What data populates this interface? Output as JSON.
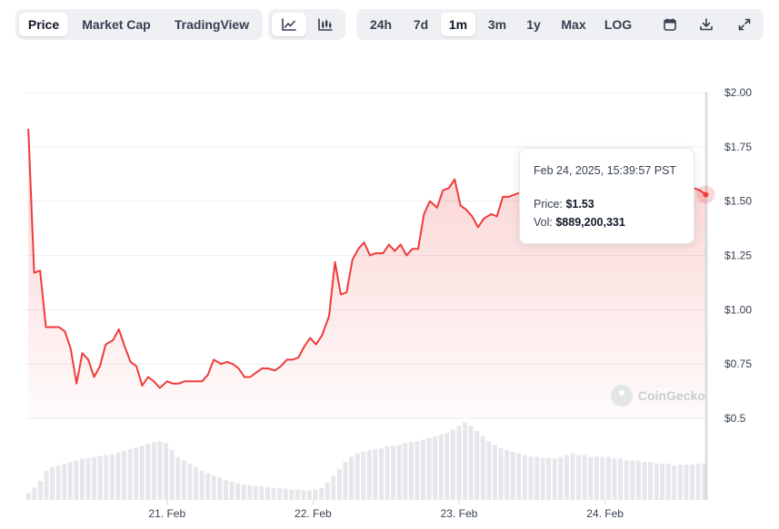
{
  "toolbar": {
    "metric_tabs": [
      {
        "label": "Price",
        "active": true
      },
      {
        "label": "Market Cap",
        "active": false
      },
      {
        "label": "TradingView",
        "active": false
      }
    ],
    "chart_type_buttons": [
      {
        "icon": "line-chart-icon",
        "active": true
      },
      {
        "icon": "candlestick-chart-icon",
        "active": false
      }
    ],
    "range_buttons": [
      {
        "label": "24h",
        "active": false
      },
      {
        "label": "7d",
        "active": false
      },
      {
        "label": "1m",
        "active": true
      },
      {
        "label": "3m",
        "active": false
      },
      {
        "label": "1y",
        "active": false
      },
      {
        "label": "Max",
        "active": false
      },
      {
        "label": "LOG",
        "active": false
      }
    ],
    "action_icons": [
      "calendar-icon",
      "download-icon",
      "expand-icon"
    ]
  },
  "tooltip": {
    "date": "Feb 24, 2025, 15:39:57 PST",
    "price_label": "Price:",
    "price_value": "$1.53",
    "vol_label": "Vol:",
    "vol_value": "$889,200,331"
  },
  "watermark": "CoinGecko",
  "colors": {
    "line": "#ef3b3b",
    "volume": "#e5e7eb",
    "grid": "#eeeeee"
  },
  "chart_data": {
    "type": "area",
    "y_ticks": [
      "$2.00",
      "$1.75",
      "$1.50",
      "$1.25",
      "$1.00",
      "$0.75",
      "$0.5"
    ],
    "ylim": [
      0.5,
      2.0
    ],
    "y_axis_side": "right",
    "x_ticks": [
      {
        "label": "21. Feb",
        "x": 20.95
      },
      {
        "label": "22. Feb",
        "x": 21.95
      },
      {
        "label": "23. Feb",
        "x": 22.95
      },
      {
        "label": "24. Feb",
        "x": 23.95
      }
    ],
    "xlim": [
      19.98,
      24.65
    ],
    "grid": true,
    "series": [
      {
        "x": [
          20.0,
          20.04,
          20.08,
          20.12,
          20.16,
          20.21,
          20.25,
          20.29,
          20.33,
          20.37,
          20.41,
          20.45,
          20.49,
          20.53,
          20.58,
          20.62,
          20.66,
          20.7,
          20.74,
          20.78,
          20.82,
          20.86,
          20.9,
          20.95,
          20.99,
          21.03,
          21.07,
          21.11,
          21.15,
          21.19,
          21.23,
          21.27,
          21.32,
          21.36,
          21.4,
          21.44,
          21.48,
          21.52,
          21.56,
          21.6,
          21.64,
          21.69,
          21.73,
          21.77,
          21.81,
          21.85,
          21.89,
          21.93,
          21.97,
          22.01,
          22.06,
          22.1,
          22.14,
          22.18,
          22.22,
          22.26,
          22.3,
          22.34,
          22.38,
          22.43,
          22.47,
          22.51,
          22.55,
          22.59,
          22.63,
          22.67,
          22.71,
          22.75,
          22.8,
          22.84,
          22.88,
          22.92,
          22.96,
          23.0,
          23.04,
          23.08,
          23.12,
          23.17,
          23.21,
          23.25,
          23.29,
          23.33,
          23.37,
          23.41,
          23.45,
          23.49,
          23.54,
          23.58,
          23.62,
          23.66,
          23.7,
          23.74,
          23.78,
          23.82,
          23.86,
          23.91,
          23.95,
          23.99,
          24.03,
          24.07,
          24.11,
          24.15,
          24.19,
          24.23,
          24.28,
          24.32,
          24.36,
          24.4,
          24.44,
          24.48,
          24.52,
          24.56,
          24.6,
          24.64
        ],
        "values": [
          1.83,
          1.17,
          1.18,
          0.92,
          0.92,
          0.92,
          0.9,
          0.82,
          0.66,
          0.8,
          0.77,
          0.69,
          0.74,
          0.84,
          0.86,
          0.91,
          0.83,
          0.76,
          0.74,
          0.65,
          0.69,
          0.67,
          0.64,
          0.67,
          0.66,
          0.66,
          0.67,
          0.67,
          0.67,
          0.67,
          0.7,
          0.77,
          0.75,
          0.76,
          0.75,
          0.73,
          0.69,
          0.69,
          0.71,
          0.73,
          0.73,
          0.72,
          0.74,
          0.77,
          0.77,
          0.78,
          0.83,
          0.87,
          0.84,
          0.88,
          0.97,
          1.22,
          1.07,
          1.08,
          1.23,
          1.28,
          1.31,
          1.25,
          1.26,
          1.26,
          1.3,
          1.27,
          1.3,
          1.25,
          1.28,
          1.28,
          1.44,
          1.5,
          1.47,
          1.55,
          1.56,
          1.6,
          1.48,
          1.46,
          1.43,
          1.38,
          1.42,
          1.44,
          1.43,
          1.52,
          1.52,
          1.53,
          1.54,
          1.55,
          1.54,
          1.54,
          1.55,
          1.53,
          1.53,
          1.53,
          1.54,
          1.54,
          1.55,
          1.56,
          1.57,
          1.56,
          1.56,
          1.57,
          1.56,
          1.57,
          1.56,
          1.55,
          1.56,
          1.54,
          1.55,
          1.53,
          1.54,
          1.55,
          1.54,
          1.55,
          1.54,
          1.56,
          1.55,
          1.53
        ]
      }
    ],
    "volume_relative": [
      0.08,
      0.14,
      0.22,
      0.34,
      0.38,
      0.4,
      0.42,
      0.44,
      0.46,
      0.48,
      0.49,
      0.5,
      0.51,
      0.52,
      0.53,
      0.55,
      0.57,
      0.59,
      0.61,
      0.63,
      0.65,
      0.67,
      0.68,
      0.66,
      0.58,
      0.5,
      0.46,
      0.42,
      0.38,
      0.34,
      0.31,
      0.28,
      0.26,
      0.23,
      0.21,
      0.19,
      0.18,
      0.17,
      0.16,
      0.16,
      0.15,
      0.14,
      0.14,
      0.13,
      0.12,
      0.12,
      0.11,
      0.11,
      0.12,
      0.14,
      0.2,
      0.28,
      0.36,
      0.44,
      0.5,
      0.54,
      0.56,
      0.58,
      0.59,
      0.6,
      0.62,
      0.63,
      0.64,
      0.66,
      0.67,
      0.68,
      0.7,
      0.72,
      0.74,
      0.76,
      0.78,
      0.82,
      0.86,
      0.9,
      0.86,
      0.8,
      0.74,
      0.68,
      0.64,
      0.6,
      0.58,
      0.56,
      0.54,
      0.52,
      0.5,
      0.5,
      0.49,
      0.49,
      0.48,
      0.5,
      0.52,
      0.54,
      0.52,
      0.52,
      0.5,
      0.5,
      0.5,
      0.5,
      0.48,
      0.48,
      0.46,
      0.46,
      0.46,
      0.44,
      0.44,
      0.42,
      0.42,
      0.42,
      0.4,
      0.41,
      0.41,
      0.41,
      0.42,
      0.42
    ],
    "highlight_point": {
      "x": 24.64,
      "y": 1.53
    }
  }
}
